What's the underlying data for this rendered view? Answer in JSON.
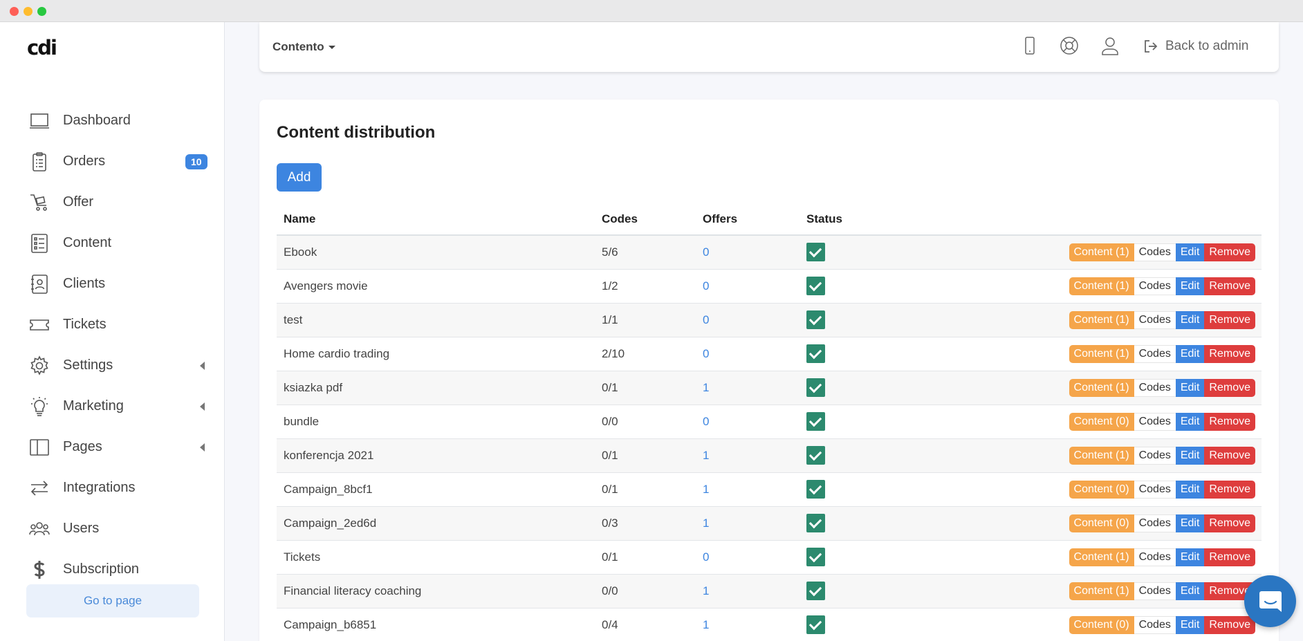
{
  "sidebar": {
    "logo": "cdi",
    "items": [
      {
        "label": "Dashboard",
        "icon": "monitor-icon"
      },
      {
        "label": "Orders",
        "icon": "clipboard-icon",
        "badge": "10"
      },
      {
        "label": "Offer",
        "icon": "cart-icon"
      },
      {
        "label": "Content",
        "icon": "list-icon"
      },
      {
        "label": "Clients",
        "icon": "contact-icon"
      },
      {
        "label": "Tickets",
        "icon": "ticket-icon"
      },
      {
        "label": "Settings",
        "icon": "gear-icon",
        "expandable": true
      },
      {
        "label": "Marketing",
        "icon": "lightbulb-icon",
        "expandable": true
      },
      {
        "label": "Pages",
        "icon": "columns-icon",
        "expandable": true
      },
      {
        "label": "Integrations",
        "icon": "arrows-icon"
      },
      {
        "label": "Users",
        "icon": "users-icon"
      },
      {
        "label": "Subscription",
        "icon": "dollar-icon"
      }
    ],
    "go_to_page": "Go to page"
  },
  "topbar": {
    "workspace": "Contento",
    "back_to_admin": "Back to admin"
  },
  "main": {
    "title": "Content distribution",
    "add_label": "Add",
    "columns": [
      "Name",
      "Codes",
      "Offers",
      "Status"
    ],
    "rows": [
      {
        "name": "Ebook",
        "codes": "5/6",
        "offers": "0",
        "content": "Content (1)"
      },
      {
        "name": "Avengers movie",
        "codes": "1/2",
        "offers": "0",
        "content": "Content (1)"
      },
      {
        "name": "test",
        "codes": "1/1",
        "offers": "0",
        "content": "Content (1)"
      },
      {
        "name": "Home cardio trading",
        "codes": "2/10",
        "offers": "0",
        "content": "Content (1)"
      },
      {
        "name": "ksiazka pdf",
        "codes": "0/1",
        "offers": "1",
        "content": "Content (1)"
      },
      {
        "name": "bundle",
        "codes": "0/0",
        "offers": "0",
        "content": "Content (0)"
      },
      {
        "name": "konferencja 2021",
        "codes": "0/1",
        "offers": "1",
        "content": "Content (1)"
      },
      {
        "name": "Campaign_8bcf1",
        "codes": "0/1",
        "offers": "1",
        "content": "Content (0)"
      },
      {
        "name": "Campaign_2ed6d",
        "codes": "0/3",
        "offers": "1",
        "content": "Content (0)"
      },
      {
        "name": "Tickets",
        "codes": "0/1",
        "offers": "0",
        "content": "Content (1)"
      },
      {
        "name": "Financial literacy coaching",
        "codes": "0/0",
        "offers": "1",
        "content": "Content (1)"
      },
      {
        "name": "Campaign_b6851",
        "codes": "0/4",
        "offers": "1",
        "content": "Content (0)"
      }
    ],
    "action_labels": {
      "codes": "Codes",
      "edit": "Edit",
      "remove": "Remove"
    }
  },
  "colors": {
    "primary": "#3d85e0",
    "content_button": "#f5a54a",
    "remove_button": "#de3d3d",
    "status_check": "#2c8a6e"
  }
}
